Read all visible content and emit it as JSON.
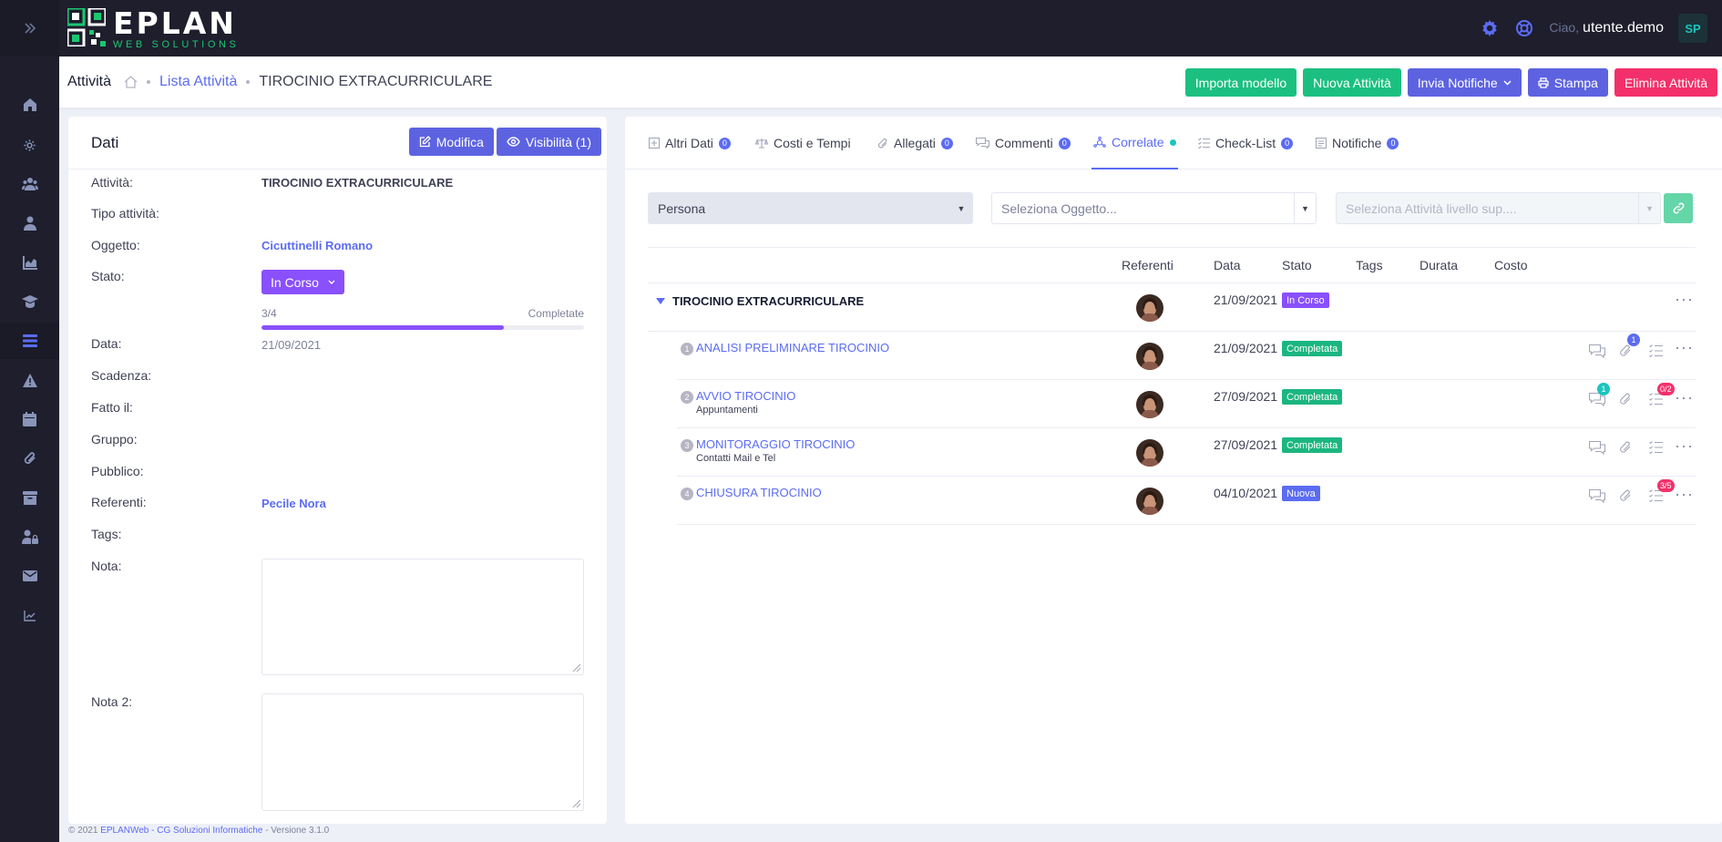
{
  "topbar": {
    "logo_word": "EPLAN",
    "logo_sub": "WEB SOLUTIONS",
    "greeting": "Ciao,",
    "username": "utente.demo",
    "avatar_initials": "SP"
  },
  "subheader": {
    "title": "Attività",
    "breadcrumb_link": "Lista Attività",
    "breadcrumb_current": "TIROCINIO EXTRACURRICULARE",
    "actions": {
      "import": "Importa modello",
      "new": "Nuova Attività",
      "notify": "Invia Notifiche",
      "print": "Stampa",
      "delete": "Elimina Attività"
    }
  },
  "dati": {
    "title": "Dati",
    "edit_label": "Modifica",
    "visibility_label": "Visibilità (1)",
    "fields": {
      "attivita_label": "Attività:",
      "attivita_value": "TIROCINIO EXTRACURRICULARE",
      "tipo_label": "Tipo attività:",
      "oggetto_label": "Oggetto:",
      "oggetto_value": "Cicuttinelli Romano",
      "stato_label": "Stato:",
      "stato_value": "In Corso",
      "progress_text": "3/4",
      "progress_right": "Completate",
      "progress_fraction": 0.75,
      "data_label": "Data:",
      "data_value": "21/09/2021",
      "scadenza_label": "Scadenza:",
      "fatto_label": "Fatto il:",
      "gruppo_label": "Gruppo:",
      "pubblico_label": "Pubblico:",
      "referenti_label": "Referenti:",
      "referenti_value": "Pecile Nora",
      "tags_label": "Tags:",
      "nota_label": "Nota:",
      "nota2_label": "Nota 2:"
    }
  },
  "tabs": [
    {
      "label": "Altri Dati",
      "badge": "0"
    },
    {
      "label": "Costi e Tempi"
    },
    {
      "label": "Allegati",
      "badge": "0"
    },
    {
      "label": "Commenti",
      "badge": "0"
    },
    {
      "label": "Correlate"
    },
    {
      "label": "Check-List",
      "badge": "0"
    },
    {
      "label": "Notifiche",
      "badge": "0"
    }
  ],
  "filters": {
    "persona": "Persona",
    "oggetto_placeholder": "Seleziona Oggetto...",
    "livello_placeholder": "Seleziona Attività livello sup...."
  },
  "table": {
    "headers": [
      "Referenti",
      "Data",
      "Stato",
      "Tags",
      "Durata",
      "Costo"
    ],
    "parent": {
      "title": "TIROCINIO EXTRACURRICULARE",
      "date": "21/09/2021",
      "status": "In Corso"
    },
    "rows": [
      {
        "num": "1",
        "title": "ANALISI PRELIMINARE TIROCINIO",
        "sub": "",
        "date": "21/09/2021",
        "status": "Completata",
        "attach_badge": "1"
      },
      {
        "num": "2",
        "title": "AVVIO TIROCINIO",
        "sub": "Appuntamenti",
        "date": "27/09/2021",
        "status": "Completata",
        "comment_badge": "1",
        "check_badge": "0/2"
      },
      {
        "num": "3",
        "title": "MONITORAGGIO TIROCINIO",
        "sub": "Contatti Mail e Tel",
        "date": "27/09/2021",
        "status": "Completata"
      },
      {
        "num": "4",
        "title": "CHIUSURA TIROCINIO",
        "sub": "",
        "date": "04/10/2021",
        "status": "Nuova",
        "check_badge": "3/5"
      }
    ]
  },
  "footer": {
    "year": "© 2021",
    "link": "EPLANWeb - CG Soluzioni Informatiche",
    "version": "- Versione 3.1.0"
  },
  "colors": {
    "topbar": "#1e1e2d",
    "accent": "#5b6cf3",
    "green": "#1bc081",
    "purple": "#8950fc",
    "pink": "#f3306a"
  }
}
